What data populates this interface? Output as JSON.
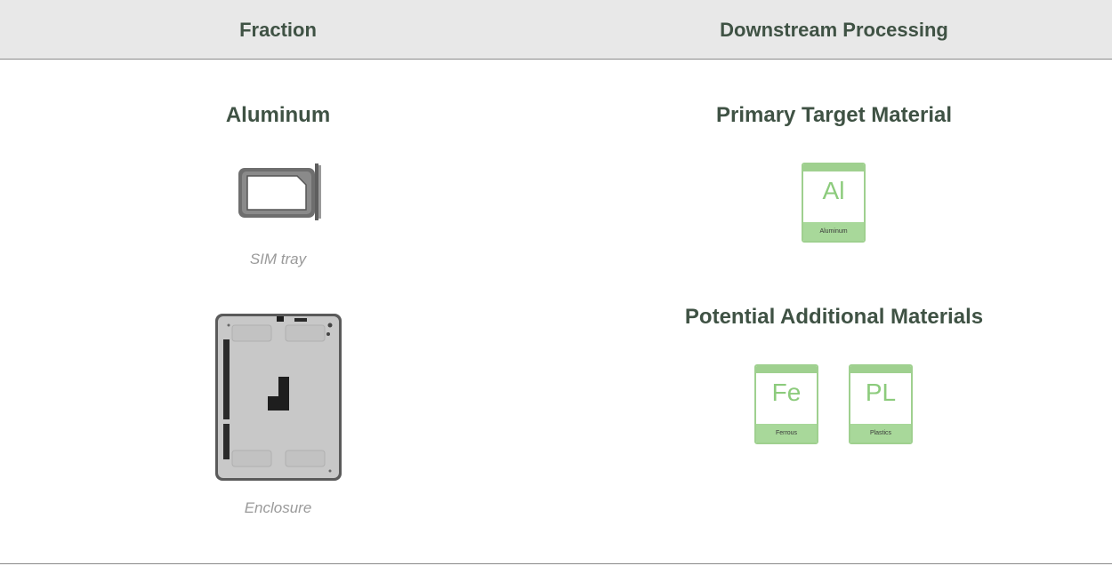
{
  "header": {
    "col1": "Fraction",
    "col2": "Downstream Processing"
  },
  "fraction": {
    "title": "Aluminum",
    "items": [
      {
        "caption": "SIM tray",
        "icon": "sim-tray-icon"
      },
      {
        "caption": "Enclosure",
        "icon": "enclosure-icon"
      }
    ]
  },
  "processing": {
    "primary_title": "Primary Target Material",
    "primary": [
      {
        "symbol": "Al",
        "name": "Aluminum"
      }
    ],
    "additional_title": "Potential Additional Materials",
    "additional": [
      {
        "symbol": "Fe",
        "name": "Ferrous"
      },
      {
        "symbol": "PL",
        "name": "Plastics"
      }
    ]
  },
  "colors": {
    "heading": "#3f5244",
    "tile_green": "#9fd08f",
    "header_bg": "#e8e8e8"
  }
}
